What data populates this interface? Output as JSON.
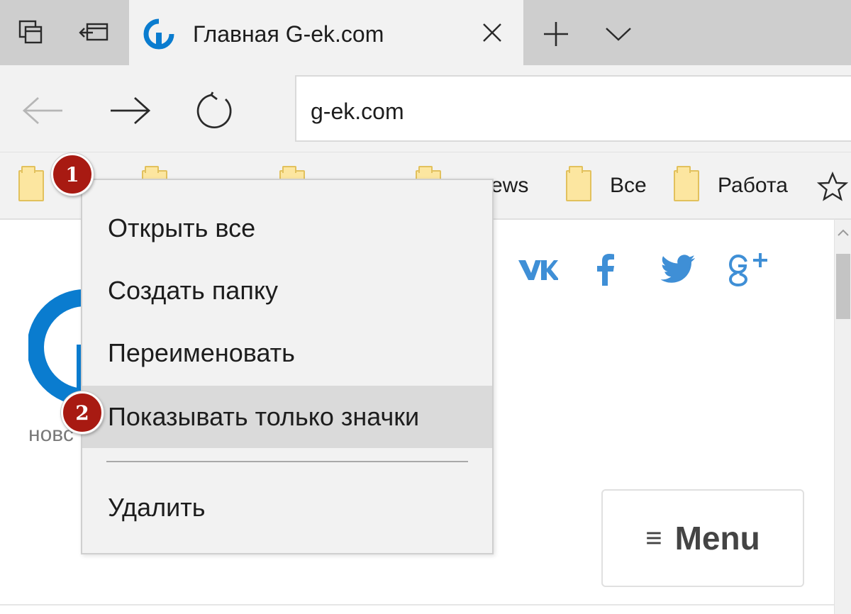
{
  "browser": {
    "tab": {
      "title": "Главная G-ek.com"
    },
    "address": {
      "value": "g-ek.com"
    }
  },
  "favorites": {
    "items": [
      {
        "label": ""
      },
      {
        "label": ""
      },
      {
        "label": ""
      },
      {
        "label": "News"
      },
      {
        "label": "Все"
      },
      {
        "label": "Работа"
      }
    ],
    "visible_partial_label": "ews"
  },
  "context_menu": {
    "items": [
      {
        "label": "Открыть все"
      },
      {
        "label": "Создать папку"
      },
      {
        "label": "Переименовать"
      },
      {
        "label": "Показывать только значки",
        "highlighted": true
      },
      {
        "label": "Удалить"
      }
    ]
  },
  "badges": {
    "step1": "1",
    "step2": "2"
  },
  "page": {
    "logo_subtitle": "новс",
    "menu_button": {
      "glyph": "≡",
      "label": "Menu"
    },
    "social": [
      "vk-icon",
      "facebook-icon",
      "twitter-icon",
      "google-plus-icon"
    ]
  },
  "colors": {
    "accent_blue": "#0a7ccf",
    "social_blue": "#3f8fd6",
    "badge_red": "#a81a12",
    "folder_yellow": "#fce6a0"
  }
}
